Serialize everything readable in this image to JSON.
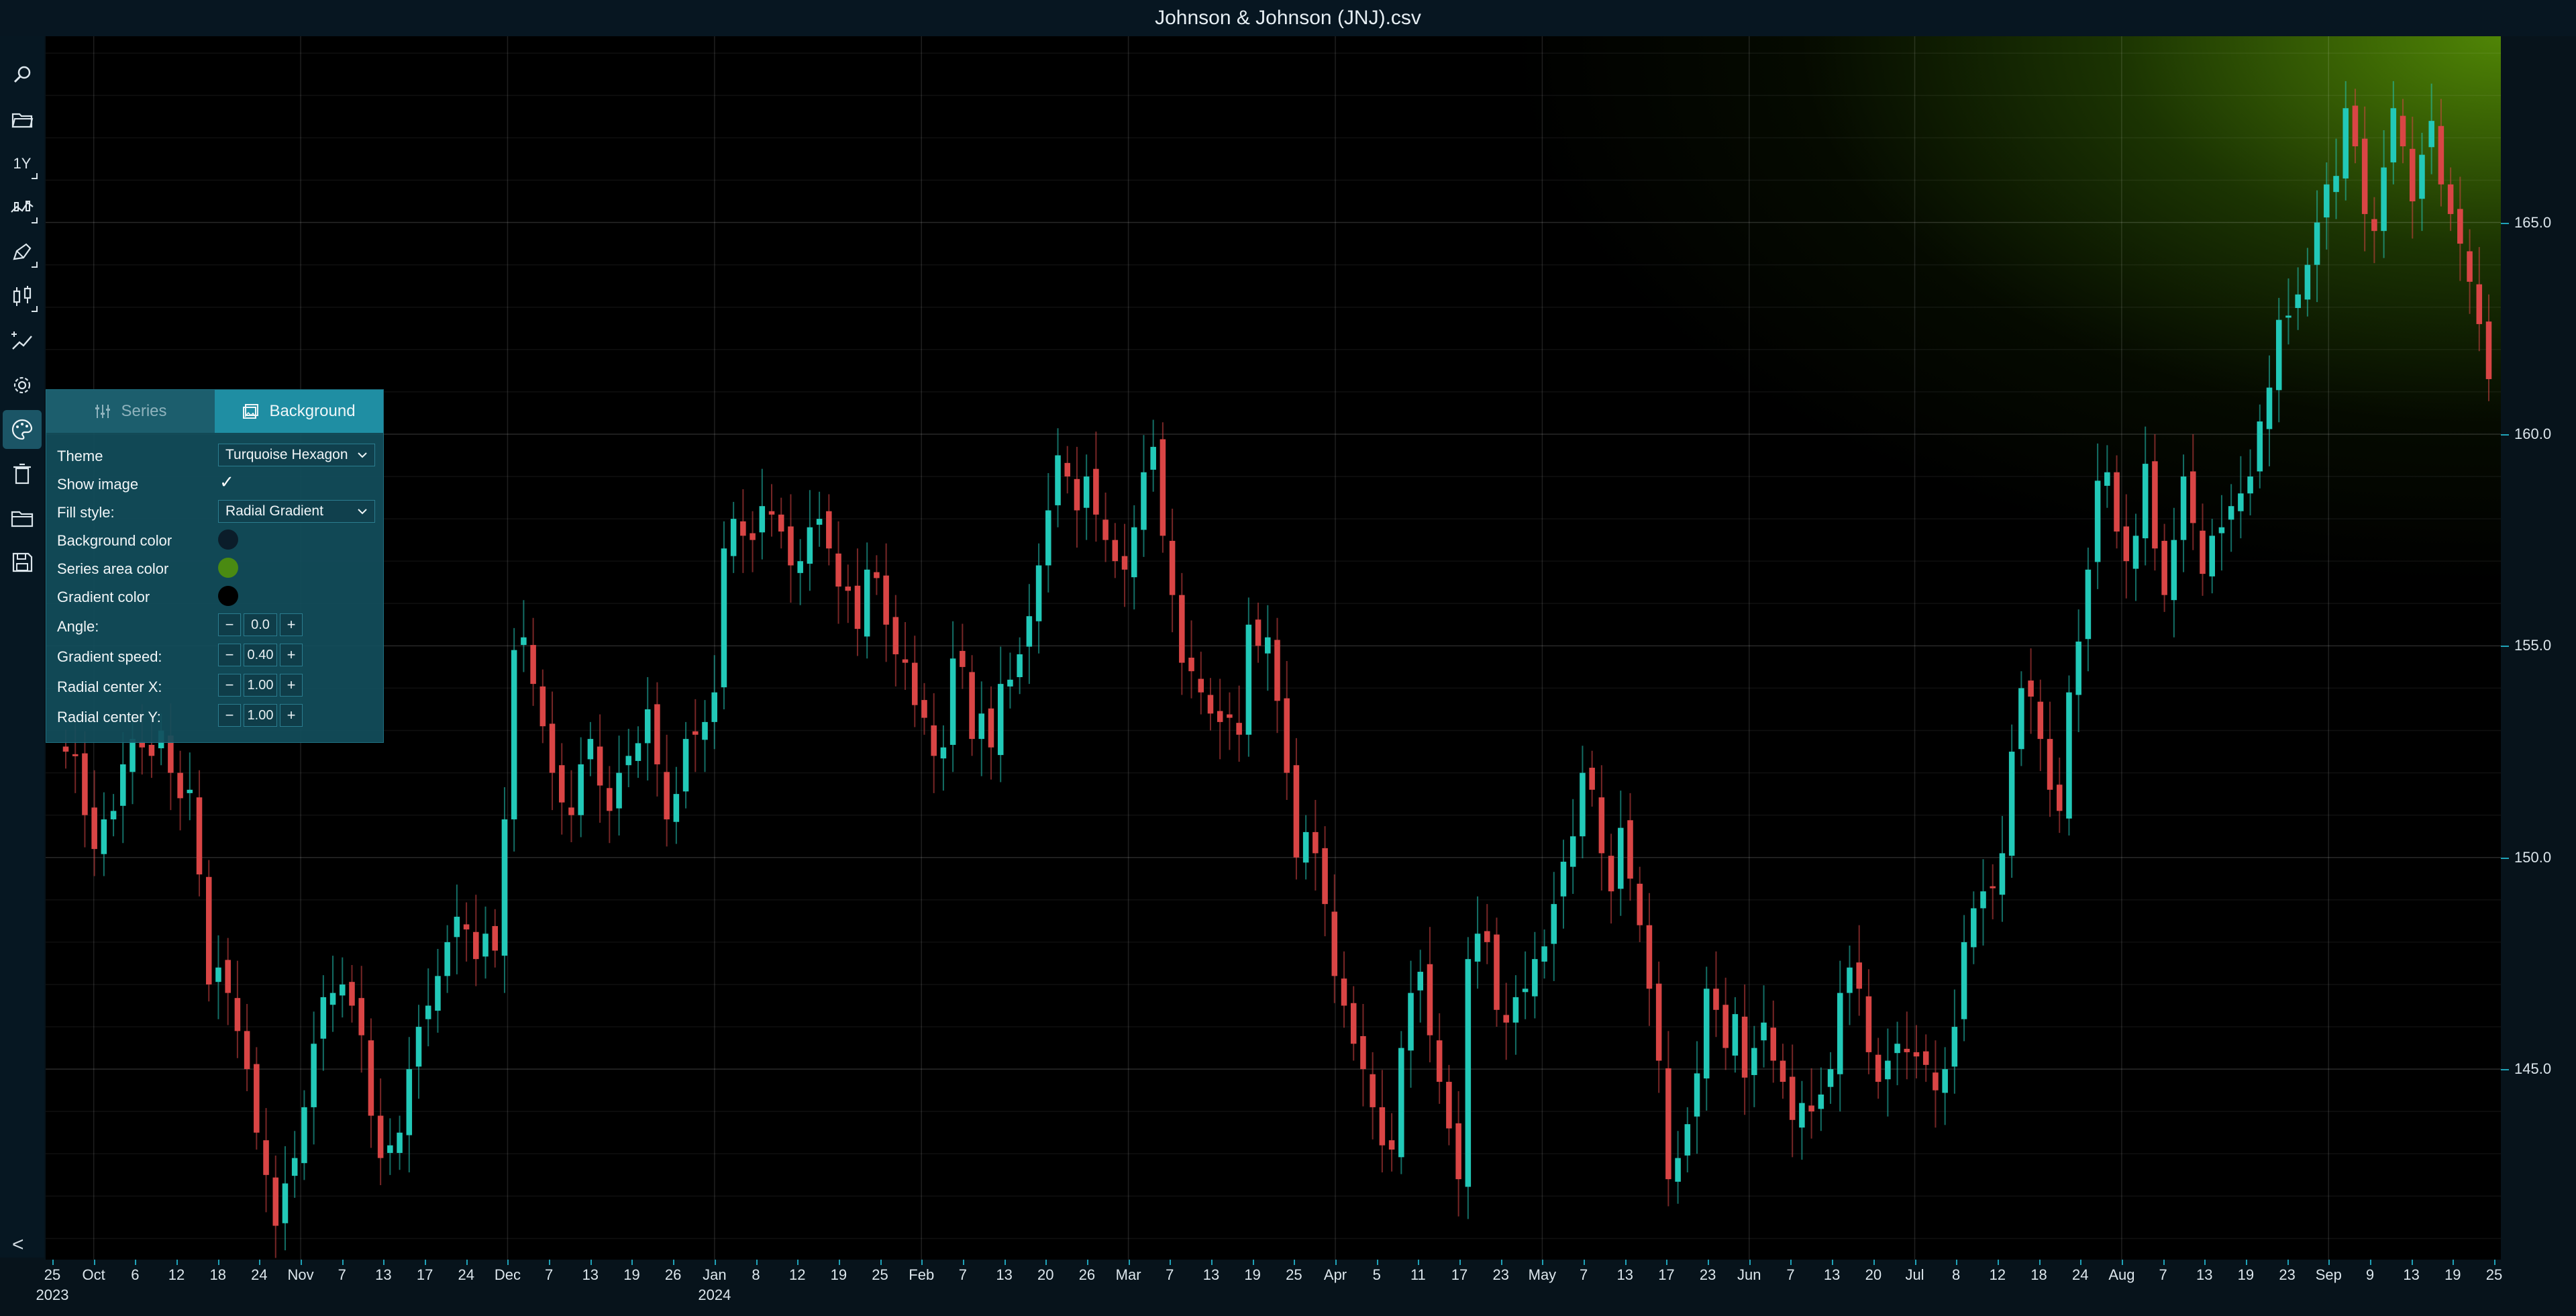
{
  "window": {
    "title": "Johnson & Johnson (JNJ).csv"
  },
  "toolbar": {
    "items": [
      {
        "name": "search-icon"
      },
      {
        "name": "open-folder-icon"
      },
      {
        "name": "timeframe-button",
        "label": "1Y"
      },
      {
        "name": "series-icon"
      },
      {
        "name": "draw-icon"
      },
      {
        "name": "candlestick-icon"
      },
      {
        "name": "indicator-icon"
      },
      {
        "name": "settings-icon"
      },
      {
        "name": "palette-icon"
      },
      {
        "name": "delete-icon"
      },
      {
        "name": "folder-icon"
      },
      {
        "name": "save-icon"
      }
    ],
    "collapse_label": "<"
  },
  "panel": {
    "tabs": [
      {
        "label": "Series",
        "active": false,
        "icon": "sliders-icon"
      },
      {
        "label": "Background",
        "active": true,
        "icon": "image-icon"
      }
    ],
    "theme": {
      "label": "Theme",
      "value": "Turquoise Hexagon"
    },
    "show_image": {
      "label": "Show image",
      "checked": true,
      "mark": "✓"
    },
    "fill_style": {
      "label": "Fill style:",
      "value": "Radial Gradient"
    },
    "background_color": {
      "label": "Background color",
      "color": "#0b1d2a"
    },
    "series_area_color": {
      "label": "Series area color",
      "color": "#4a8a12"
    },
    "gradient_color": {
      "label": "Gradient color",
      "color": "#000000"
    },
    "angle": {
      "label": "Angle:",
      "value": "0.0"
    },
    "gradient_speed": {
      "label": "Gradient speed:",
      "value": "0.40"
    },
    "radial_center_x": {
      "label": "Radial center X:",
      "value": "1.00"
    },
    "radial_center_y": {
      "label": "Radial center Y:",
      "value": "1.00"
    },
    "minus": "−",
    "plus": "+"
  },
  "chart_data": {
    "type": "candlestick",
    "title": "Johnson & Johnson (JNJ).csv",
    "ylim": [
      140.5,
      169.4
    ],
    "y_ticks": [
      "165.0",
      "160.0",
      "155.0",
      "150.0",
      "145.0"
    ],
    "x_tick_labels": [
      "25",
      "Oct",
      "6",
      "12",
      "18",
      "24",
      "Nov",
      "7",
      "13",
      "17",
      "24",
      "Dec",
      "7",
      "13",
      "19",
      "26",
      "Jan",
      "8",
      "12",
      "19",
      "25",
      "Feb",
      "7",
      "13",
      "20",
      "26",
      "Mar",
      "7",
      "13",
      "19",
      "25",
      "Apr",
      "5",
      "11",
      "17",
      "23",
      "May",
      "7",
      "13",
      "17",
      "23",
      "Jun",
      "7",
      "13",
      "20",
      "Jul",
      "8",
      "12",
      "18",
      "24",
      "Aug",
      "7",
      "13",
      "19",
      "23",
      "Sep",
      "9",
      "13",
      "19",
      "25"
    ],
    "x_sub_labels": [
      {
        "under": "25",
        "text": "2023"
      },
      {
        "under": "Jan",
        "text": "2024"
      }
    ],
    "up_color": "#22c9b8",
    "down_color": "#d94545",
    "closes": [
      152.5,
      152.4,
      151.0,
      150.2,
      150.9,
      151.1,
      152.2,
      152.8,
      152.6,
      152.4,
      153.0,
      152.0,
      151.4,
      151.6,
      149.6,
      147.0,
      147.4,
      146.8,
      145.9,
      145.0,
      143.5,
      142.5,
      141.3,
      142.3,
      142.9,
      144.1,
      145.6,
      146.7,
      146.8,
      147.0,
      146.5,
      145.8,
      143.9,
      142.9,
      143.2,
      143.5,
      145.0,
      146.0,
      146.5,
      147.2,
      148.0,
      148.6,
      148.3,
      147.6,
      148.2,
      147.8,
      150.9,
      154.9,
      155.2,
      154.1,
      153.1,
      152.0,
      151.3,
      151.0,
      152.2,
      152.8,
      151.7,
      151.1,
      152.0,
      152.4,
      152.7,
      153.5,
      152.2,
      150.9,
      151.5,
      152.8,
      152.9,
      153.2,
      153.9,
      157.3,
      158.0,
      157.6,
      157.5,
      158.3,
      158.1,
      157.7,
      156.9,
      157.0,
      157.8,
      158.0,
      157.3,
      156.4,
      156.3,
      155.4,
      156.8,
      156.6,
      155.5,
      154.8,
      154.6,
      153.6,
      153.3,
      152.4,
      152.6,
      154.7,
      154.5,
      152.8,
      153.4,
      152.6,
      154.1,
      154.2,
      154.8,
      155.7,
      156.9,
      158.2,
      159.5,
      159.0,
      158.2,
      159.0,
      158.1,
      157.5,
      157.0,
      156.8,
      157.8,
      159.1,
      159.7,
      157.6,
      156.2,
      154.6,
      154.4,
      153.9,
      153.4,
      153.2,
      153.3,
      152.9,
      155.5,
      155.0,
      155.2,
      153.7,
      152.0,
      150.0,
      150.6,
      150.1,
      148.9,
      147.2,
      146.5,
      145.6,
      145.0,
      144.1,
      143.2,
      143.1,
      145.5,
      146.8,
      147.3,
      145.8,
      144.7,
      143.6,
      142.4,
      147.6,
      148.2,
      148.0,
      146.4,
      146.1,
      146.7,
      146.9,
      147.6,
      147.9,
      148.9,
      149.9,
      150.5,
      152.0,
      151.6,
      150.1,
      149.2,
      150.7,
      149.5,
      148.4,
      146.9,
      145.2,
      142.4,
      142.9,
      143.7,
      144.9,
      146.9,
      146.4,
      145.5,
      146.3,
      144.8,
      145.5,
      146.1,
      145.2,
      144.7,
      143.8,
      144.2,
      144.0,
      144.4,
      145.0,
      146.8,
      147.4,
      146.9,
      145.4,
      144.7,
      145.2,
      145.6,
      145.4,
      145.3,
      145.1,
      144.5,
      145.0,
      146.0,
      148.0,
      148.8,
      149.2,
      149.3,
      150.1,
      152.5,
      154.0,
      153.8,
      152.8,
      151.6,
      151.1,
      153.9,
      155.1,
      156.8,
      158.9,
      159.1,
      157.7,
      157.0,
      157.6,
      159.3,
      157.3,
      156.2,
      157.5,
      159.0,
      157.9,
      156.7,
      157.6,
      157.8,
      158.3,
      158.6,
      159.0,
      160.3,
      161.1,
      162.7,
      162.8,
      163.3,
      164.0,
      165.0,
      165.9,
      166.1,
      167.7,
      166.8,
      165.2,
      164.8,
      166.3,
      167.7,
      166.8,
      165.5,
      166.6,
      167.4,
      165.9,
      165.2,
      164.5,
      163.6,
      162.6,
      161.3
    ]
  }
}
